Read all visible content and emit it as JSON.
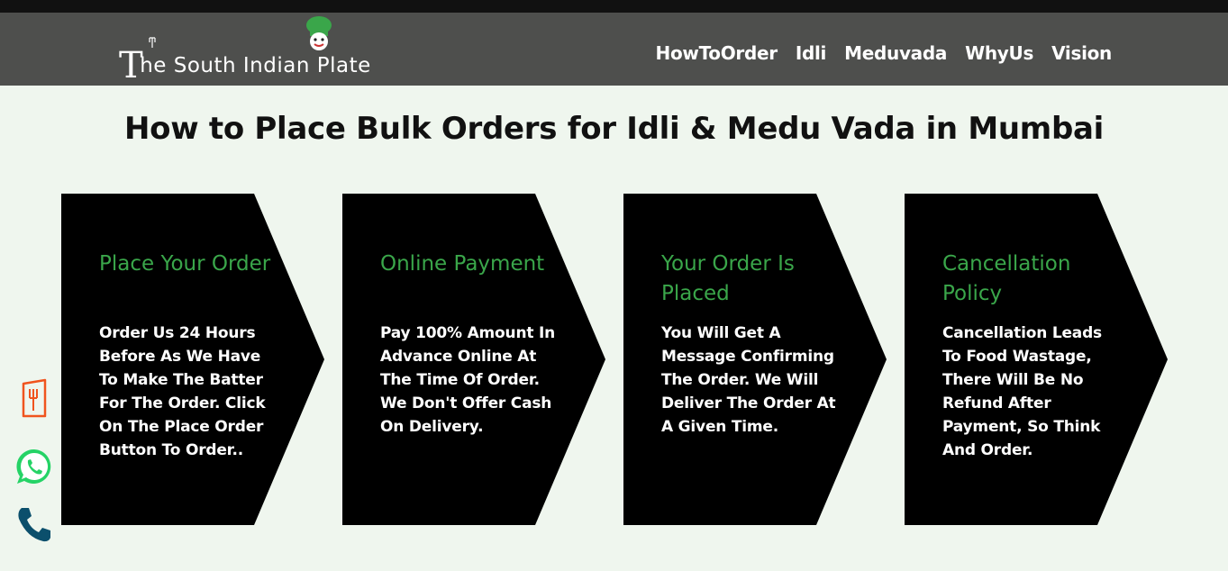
{
  "brand": {
    "first_letter": "T",
    "rest": "he South Indian Plate",
    "colors": {
      "chef_hat": "#3aa64a"
    }
  },
  "nav": [
    {
      "label": "HowToOrder"
    },
    {
      "label": "Idli"
    },
    {
      "label": "Meduvada"
    },
    {
      "label": "WhyUs"
    },
    {
      "label": "Vision"
    }
  ],
  "main": {
    "title": "How to Place Bulk Orders for Idli & Medu Vada in Mumbai",
    "steps": [
      {
        "title": "Place Your Order",
        "body": "Order Us 24 Hours Before As We Have To Make The Batter For The Order. Click On The Place Order Button To Order.."
      },
      {
        "title": "Online Payment",
        "body": "Pay 100% Amount In Advance Online At The Time Of Order. We Don't Offer Cash On Delivery."
      },
      {
        "title": "Your Order Is Placed",
        "body": "You Will Get A Message Confirming The Order. We Will Deliver The Order At A Given Time."
      },
      {
        "title": "Cancellation Policy",
        "body": "Cancellation Leads To Food Wastage, There Will Be No Refund After Payment, So Think And Order."
      }
    ]
  },
  "side_icons": [
    {
      "icon": "menu-card-icon",
      "color": "#f0541e"
    },
    {
      "icon": "whatsapp-icon",
      "color": "#25d366"
    },
    {
      "icon": "phone-icon",
      "color": "#0b4f6c"
    }
  ],
  "colors": {
    "header_bg": "#4e4f4d",
    "page_bg": "#eff6ee",
    "card_bg": "#000000",
    "step_title": "#3aa64a"
  }
}
